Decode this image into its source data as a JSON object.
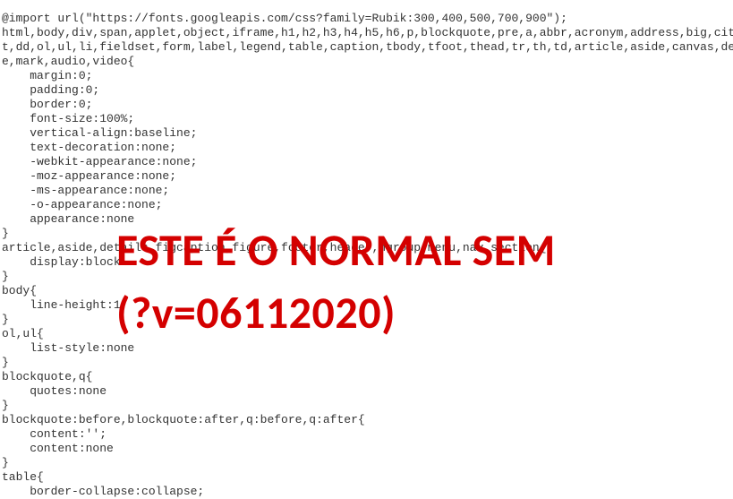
{
  "code": {
    "lines": [
      "@import url(\"https://fonts.googleapis.com/css?family=Rubik:300,400,500,700,900\");",
      "html,body,div,span,applet,object,iframe,h1,h2,h3,h4,h5,h6,p,blockquote,pre,a,abbr,acronym,address,big,cite,code,de",
      "t,dd,ol,ul,li,fieldset,form,label,legend,table,caption,tbody,tfoot,thead,tr,th,td,article,aside,canvas,details,emb",
      "e,mark,audio,video{",
      "    margin:0;",
      "    padding:0;",
      "    border:0;",
      "    font-size:100%;",
      "    vertical-align:baseline;",
      "    text-decoration:none;",
      "    -webkit-appearance:none;",
      "    -moz-appearance:none;",
      "    -ms-appearance:none;",
      "    -o-appearance:none;",
      "    appearance:none",
      "}",
      "article,aside,details,figcaption,figure,footer,header,hgroup,menu,nav,section{",
      "    display:block",
      "}",
      "body{",
      "    line-height:1",
      "}",
      "ol,ul{",
      "    list-style:none",
      "}",
      "blockquote,q{",
      "    quotes:none",
      "}",
      "blockquote:before,blockquote:after,q:before,q:after{",
      "    content:'';",
      "    content:none",
      "}",
      "table{",
      "    border-collapse:collapse;"
    ]
  },
  "overlay": {
    "line1": "ESTE É O NORMAL SEM",
    "line2": "(?v=06112020)"
  }
}
